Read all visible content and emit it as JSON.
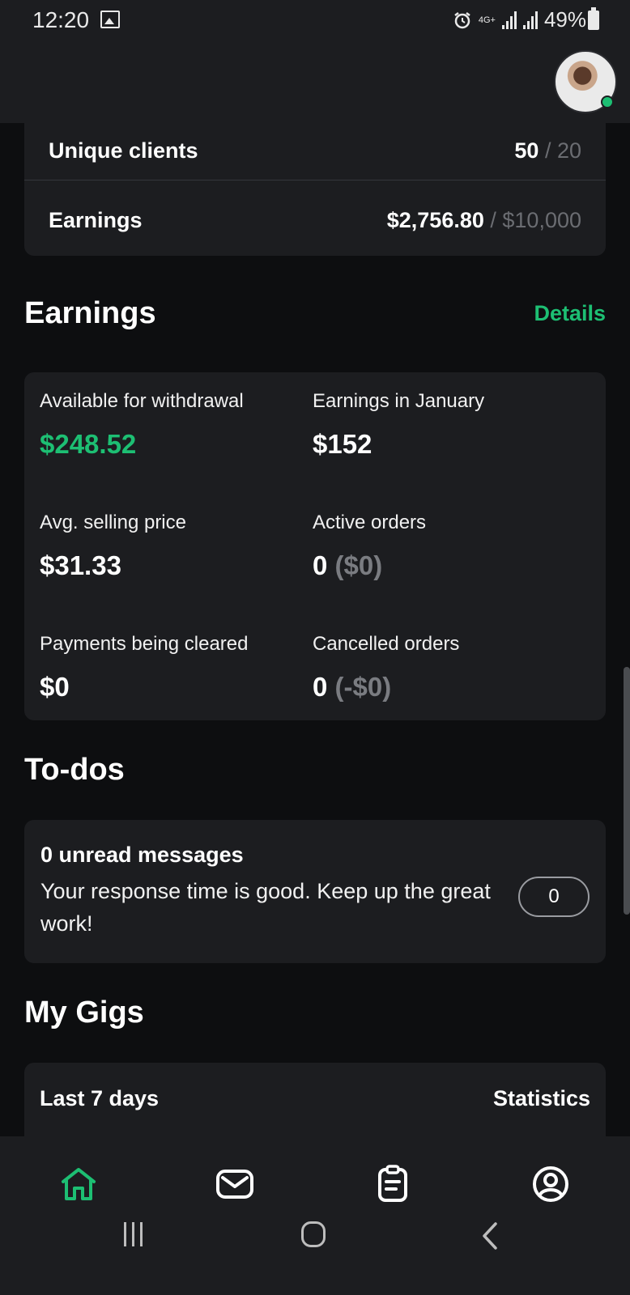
{
  "status_bar": {
    "time": "12:20",
    "network": "4G+",
    "battery": "49%",
    "icons": [
      "image-icon",
      "alarm-icon",
      "signal-icon",
      "signal-icon",
      "battery-icon"
    ]
  },
  "header": {
    "avatar_status": "online"
  },
  "goals": {
    "unique_clients_label": "Unique clients",
    "unique_clients_value": "50",
    "unique_clients_target": "/ 20",
    "earnings_label": "Earnings",
    "earnings_value": "$2,756.80",
    "earnings_target": "/ $10,000"
  },
  "earnings": {
    "title": "Earnings",
    "details_link": "Details",
    "available_label": "Available for withdrawal",
    "available_value": "$248.52",
    "month_label": "Earnings in January",
    "month_value": "$152",
    "avg_price_label": "Avg. selling price",
    "avg_price_value": "$31.33",
    "active_orders_label": "Active orders",
    "active_orders_value": "0",
    "active_orders_amount": "($0)",
    "clearing_label": "Payments being cleared",
    "clearing_value": "$0",
    "cancelled_label": "Cancelled orders",
    "cancelled_value": "0",
    "cancelled_amount": "(-$0)"
  },
  "todos": {
    "title": "To-dos",
    "messages_title": "0 unread messages",
    "messages_desc": "Your response time is good. Keep up the great work!",
    "messages_count": "0"
  },
  "gigs": {
    "title": "My Gigs",
    "period_label": "Last 7 days",
    "statistics_label": "Statistics"
  },
  "bottom_nav": {
    "items": [
      "home-icon",
      "inbox-icon",
      "orders-icon",
      "profile-icon"
    ],
    "active": "home-icon",
    "accent": "#1dbf73"
  },
  "colors": {
    "accent": "#1dbf73",
    "background": "#0d0e10",
    "card": "#1c1d20"
  }
}
